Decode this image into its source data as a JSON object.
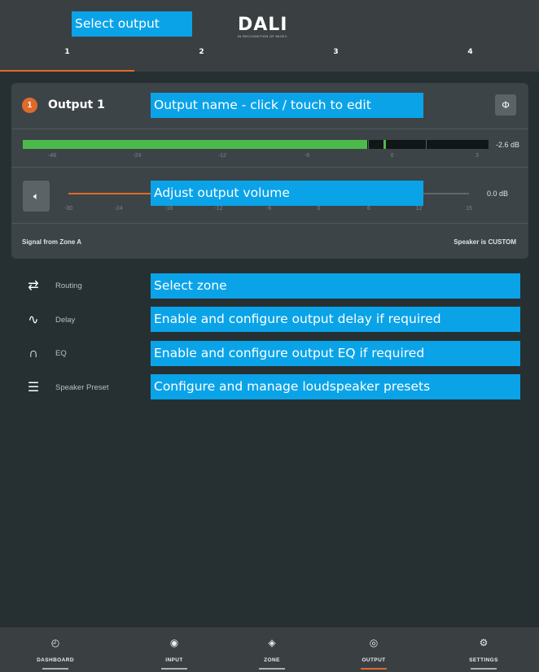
{
  "header": {
    "logo": "DALI",
    "logo_tagline": "IN RECOGNITION OF MUSIC",
    "tabs": [
      {
        "label": "1",
        "active": true
      },
      {
        "label": "2",
        "active": false
      },
      {
        "label": "3",
        "active": false
      },
      {
        "label": "4",
        "active": false
      }
    ]
  },
  "notes": {
    "select_output": "Select output",
    "output_name": "Output name - click / touch to edit",
    "adjust_volume": "Adjust output volume",
    "select_zone": "Select zone",
    "delay": "Enable and configure output delay if required",
    "eq": "Enable and configure output EQ if required",
    "preset": "Configure and manage loudspeaker presets"
  },
  "output": {
    "badge": "1",
    "title": "Output 1",
    "phase_icon": "phase-icon",
    "meter": {
      "level_fraction": 0.74,
      "readout": "-2.6 dB",
      "ticks": [
        "-48",
        "-24",
        "-12",
        "-6",
        "0",
        "3"
      ]
    },
    "volume": {
      "level_fraction": 0.24,
      "readout": "0.0 dB",
      "ticks": [
        "-30",
        "-24",
        "-18",
        "-12",
        "-6",
        "0",
        "6",
        "12",
        "15"
      ]
    },
    "signal_from": "Signal from Zone A",
    "speaker_is": "Speaker is CUSTOM"
  },
  "menu": [
    {
      "icon": "routing-icon",
      "label": "Routing"
    },
    {
      "icon": "delay-icon",
      "label": "Delay"
    },
    {
      "icon": "eq-icon",
      "label": "EQ"
    },
    {
      "icon": "speaker-preset-icon",
      "label": "Speaker Preset"
    }
  ],
  "nav": [
    {
      "icon": "dashboard-icon",
      "label": "DASHBOARD",
      "active": false
    },
    {
      "icon": "input-icon",
      "label": "INPUT",
      "active": false
    },
    {
      "icon": "zone-icon",
      "label": "ZONE",
      "active": false
    },
    {
      "icon": "output-icon",
      "label": "OUTPUT",
      "active": true
    },
    {
      "icon": "settings-icon",
      "label": "SETTINGS",
      "active": false
    }
  ],
  "colors": {
    "accent": "#e06a2a",
    "meter": "#4cba4a",
    "annotation": "#0aa3e8",
    "background": "#263033"
  }
}
